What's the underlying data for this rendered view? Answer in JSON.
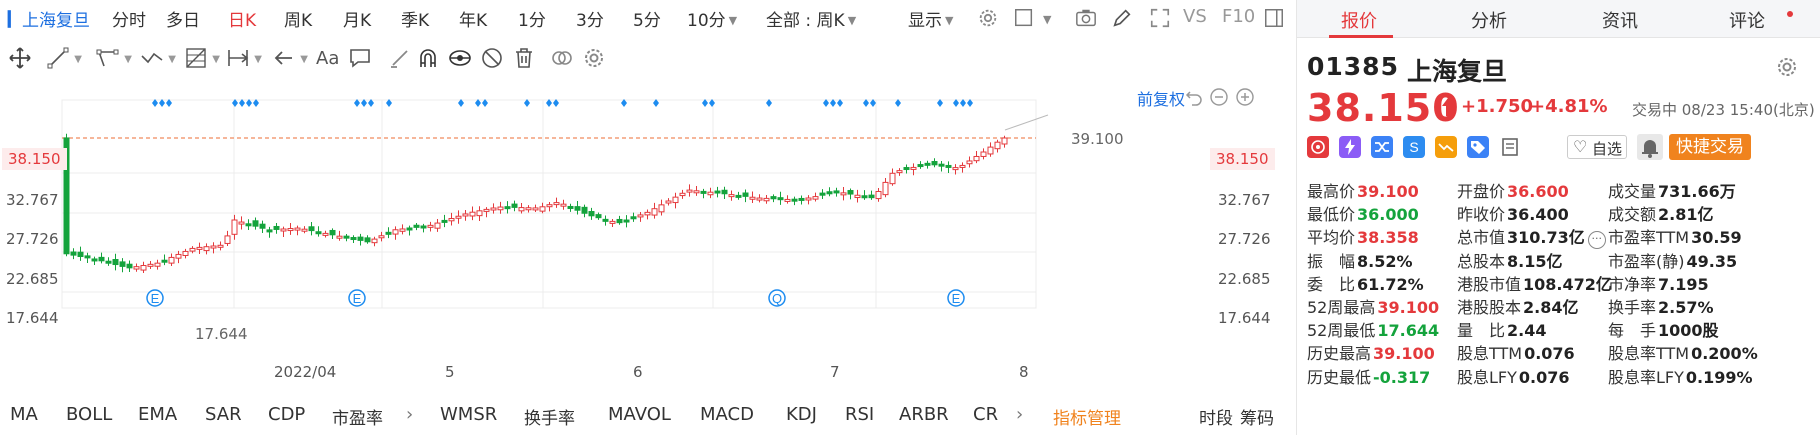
{
  "topbar": {
    "stock_name": "上海复旦",
    "periods": [
      {
        "label": "分时",
        "active": false
      },
      {
        "label": "多日",
        "active": false
      },
      {
        "label": "日K",
        "active": true
      },
      {
        "label": "周K",
        "active": false
      },
      {
        "label": "月K",
        "active": false
      },
      {
        "label": "季K",
        "active": false
      },
      {
        "label": "年K",
        "active": false
      },
      {
        "label": "1分",
        "active": false
      },
      {
        "label": "3分",
        "active": false
      },
      {
        "label": "5分",
        "active": false
      },
      {
        "label": "10分",
        "active": false
      }
    ],
    "range_select": "全部 : 周K",
    "display_label": "显示",
    "vs_label": "VS",
    "f10_label": "F10"
  },
  "chart": {
    "adjust_label": "前复权",
    "current_price_label": "38.150",
    "y_ticks": [
      "32.767",
      "27.726",
      "22.685",
      "17.644"
    ],
    "y_ticks_right": [
      "32.767",
      "27.726",
      "22.685",
      "17.644"
    ],
    "x_ticks": [
      "2022/04",
      "5",
      "6",
      "7",
      "8"
    ],
    "high_marker": "39.100",
    "low_marker": "17.644",
    "event_letters": [
      "E",
      "E",
      "Q",
      "E"
    ],
    "colors": {
      "up": "#e4393c",
      "down": "#14a33c",
      "event": "#1d8cf0",
      "grid": "#ececec"
    }
  },
  "indicators": {
    "left": [
      "MA",
      "BOLL",
      "EMA",
      "SAR",
      "CDP",
      "市盈率"
    ],
    "right": [
      "WMSR",
      "换手率",
      "MAVOL",
      "MACD",
      "KDJ",
      "RSI",
      "ARBR",
      "CR"
    ],
    "manage": "指标管理",
    "tail": [
      "时段",
      "筹码"
    ]
  },
  "panel": {
    "tabs": [
      "报价",
      "分析",
      "资讯",
      "评论"
    ],
    "code": "01385",
    "name": "上海复旦",
    "last": "38.150",
    "change": "+1.750",
    "change_pct": "+4.81%",
    "status": "交易中 08/23 15:40(北京)",
    "watch_label": "自选",
    "fast_trade": "快捷交易",
    "col1": [
      {
        "label": "最高价",
        "value": "39.100",
        "color": "red"
      },
      {
        "label": "最低价",
        "value": "36.000",
        "color": "green"
      },
      {
        "label": "平均价",
        "value": "38.358",
        "color": "red"
      },
      {
        "label": "振　幅",
        "value": "8.52%",
        "color": "dark"
      },
      {
        "label": "委　比",
        "value": "61.72%",
        "color": "dark"
      },
      {
        "label": "52周最高",
        "value": "39.100",
        "color": "red"
      },
      {
        "label": "52周最低",
        "value": "17.644",
        "color": "green"
      },
      {
        "label": "历史最高",
        "value": "39.100",
        "color": "red"
      },
      {
        "label": "历史最低",
        "value": "-0.317",
        "color": "green"
      }
    ],
    "col2": [
      {
        "label": "开盘价",
        "value": "36.600",
        "color": "red"
      },
      {
        "label": "昨收价",
        "value": "36.400",
        "color": "dark"
      },
      {
        "label": "总市值",
        "value": "310.73亿",
        "color": "dark"
      },
      {
        "label": "总股本",
        "value": "8.15亿",
        "color": "dark"
      },
      {
        "label": "港股市值",
        "value": "108.472亿",
        "color": "dark"
      },
      {
        "label": "港股股本",
        "value": "2.84亿",
        "color": "dark"
      },
      {
        "label": "量　比",
        "value": "2.44",
        "color": "dark"
      },
      {
        "label": "股息TTM",
        "value": "0.076",
        "color": "dark"
      },
      {
        "label": "股息LFY",
        "value": "0.076",
        "color": "dark"
      }
    ],
    "col3": [
      {
        "label": "成交量",
        "value": "731.66万",
        "color": "dark"
      },
      {
        "label": "成交额",
        "value": "2.81亿",
        "color": "dark"
      },
      {
        "label": "市盈率TTM",
        "value": "30.59",
        "color": "dark"
      },
      {
        "label": "市盈率(静)",
        "value": "49.35",
        "color": "dark"
      },
      {
        "label": "市净率",
        "value": "7.195",
        "color": "dark"
      },
      {
        "label": "换手率",
        "value": "2.57%",
        "color": "dark"
      },
      {
        "label": "每　手",
        "value": "1000股",
        "color": "dark"
      },
      {
        "label": "股息率TTM",
        "value": "0.200%",
        "color": "dark"
      },
      {
        "label": "股息率LFY",
        "value": "0.199%",
        "color": "dark"
      }
    ]
  }
}
